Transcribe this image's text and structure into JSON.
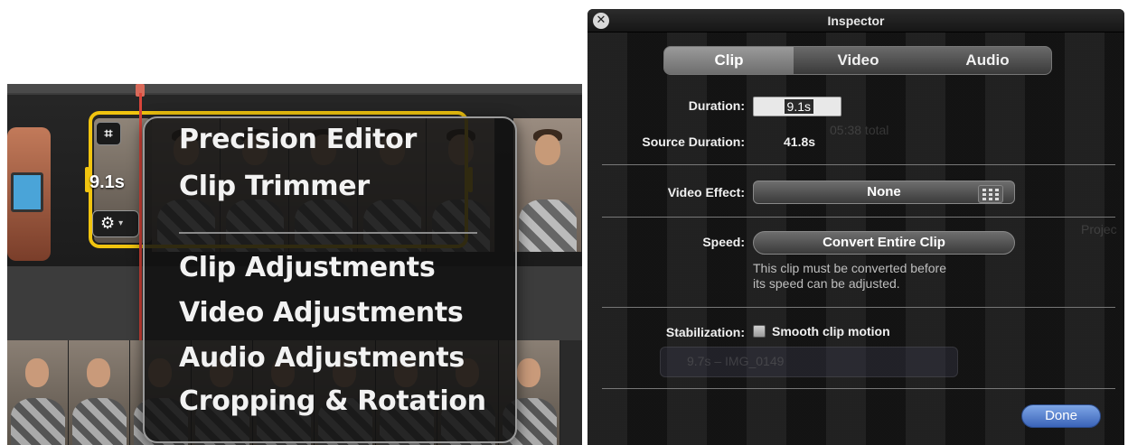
{
  "timeline": {
    "selected_clip_duration": "9.1s"
  },
  "context_menu": {
    "items": [
      "Precision Editor",
      "Clip Trimmer",
      "Clip Adjustments",
      "Video Adjustments",
      "Audio Adjustments",
      "Cropping & Rotation"
    ]
  },
  "inspector": {
    "title": "Inspector",
    "tabs": [
      "Clip",
      "Video",
      "Audio"
    ],
    "active_tab": "Clip",
    "duration_label": "Duration:",
    "duration_value": "9.1s",
    "source_duration_label": "Source Duration:",
    "source_duration_value": "41.8s",
    "video_effect_label": "Video Effect:",
    "video_effect_value": "None",
    "speed_label": "Speed:",
    "convert_button_label": "Convert Entire Clip",
    "speed_note_line1": "This clip must be converted before",
    "speed_note_line2": "its speed can be adjusted.",
    "stabilization_label": "Stabilization:",
    "stabilization_checkbox_label": "Smooth clip motion",
    "stabilization_checked": false,
    "done_button_label": "Done"
  },
  "background_ghost_text": {
    "project_length": "05:38 total",
    "projects": "Projec",
    "clip_title": "9.7s – IMG_0149"
  },
  "icons": {
    "close": "close-icon",
    "crop": "crop-icon",
    "gear": "gear-icon",
    "video_effect_grid": "grid-icon"
  },
  "colors": {
    "selection_yellow": "#f1c40f",
    "playhead_red": "#d9443a",
    "done_blue": "#3a63b8"
  }
}
